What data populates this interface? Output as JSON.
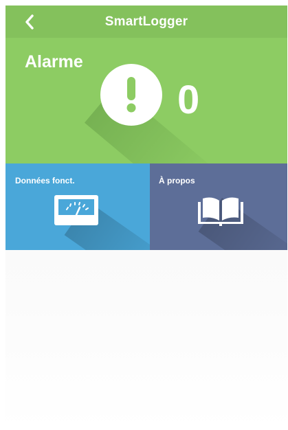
{
  "header": {
    "title": "SmartLogger",
    "back_icon": "chevron-left-icon",
    "color": "#84c15c"
  },
  "alarm": {
    "label": "Alarme",
    "count": "0",
    "icon": "exclamation-circle-icon",
    "color": "#8dcc63"
  },
  "tiles": [
    {
      "label": "Données fonct.",
      "icon": "gauge-meter-icon",
      "color": "#4aa7d9"
    },
    {
      "label": "À propos",
      "icon": "open-book-icon",
      "color": "#5d6e98"
    }
  ]
}
